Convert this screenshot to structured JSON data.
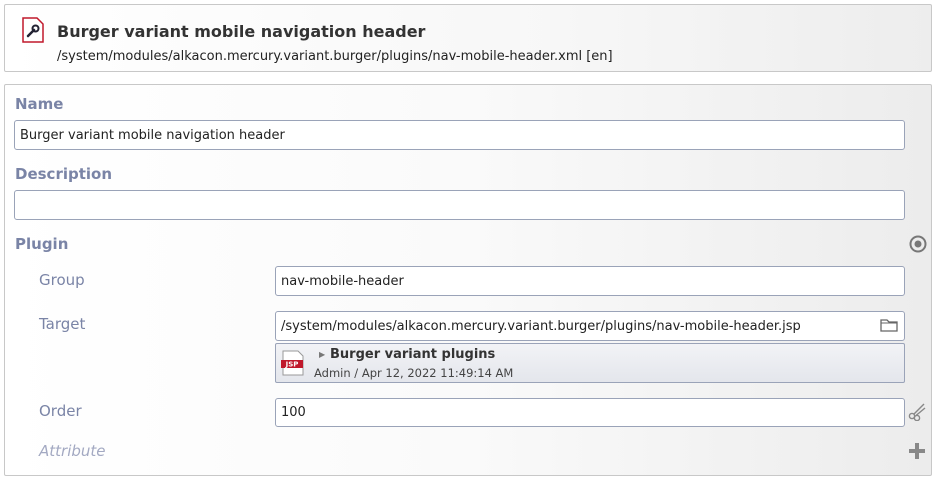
{
  "header": {
    "title": "Burger variant mobile navigation header",
    "path": "/system/modules/alkacon.mercury.variant.burger/plugins/nav-mobile-header.xml [en]",
    "icon": "wrench-file-icon"
  },
  "form": {
    "name_label": "Name",
    "name_value": "Burger variant mobile navigation header",
    "description_label": "Description",
    "description_value": "",
    "plugin_label": "Plugin",
    "plugin": {
      "group_label": "Group",
      "group_value": "nav-mobile-header",
      "target_label": "Target",
      "target_value": "/system/modules/alkacon.mercury.variant.burger/plugins/nav-mobile-header.jsp",
      "resource": {
        "badge": "JSP",
        "title": "Burger variant plugins",
        "meta": "Admin / Apr 12, 2022 11:49:14 AM"
      },
      "order_label": "Order",
      "order_value": "100",
      "attribute_label": "Attribute"
    }
  },
  "colors": {
    "label": "#7a84a6",
    "border": "#9aa3b8",
    "jsp_red": "#c0182b"
  }
}
